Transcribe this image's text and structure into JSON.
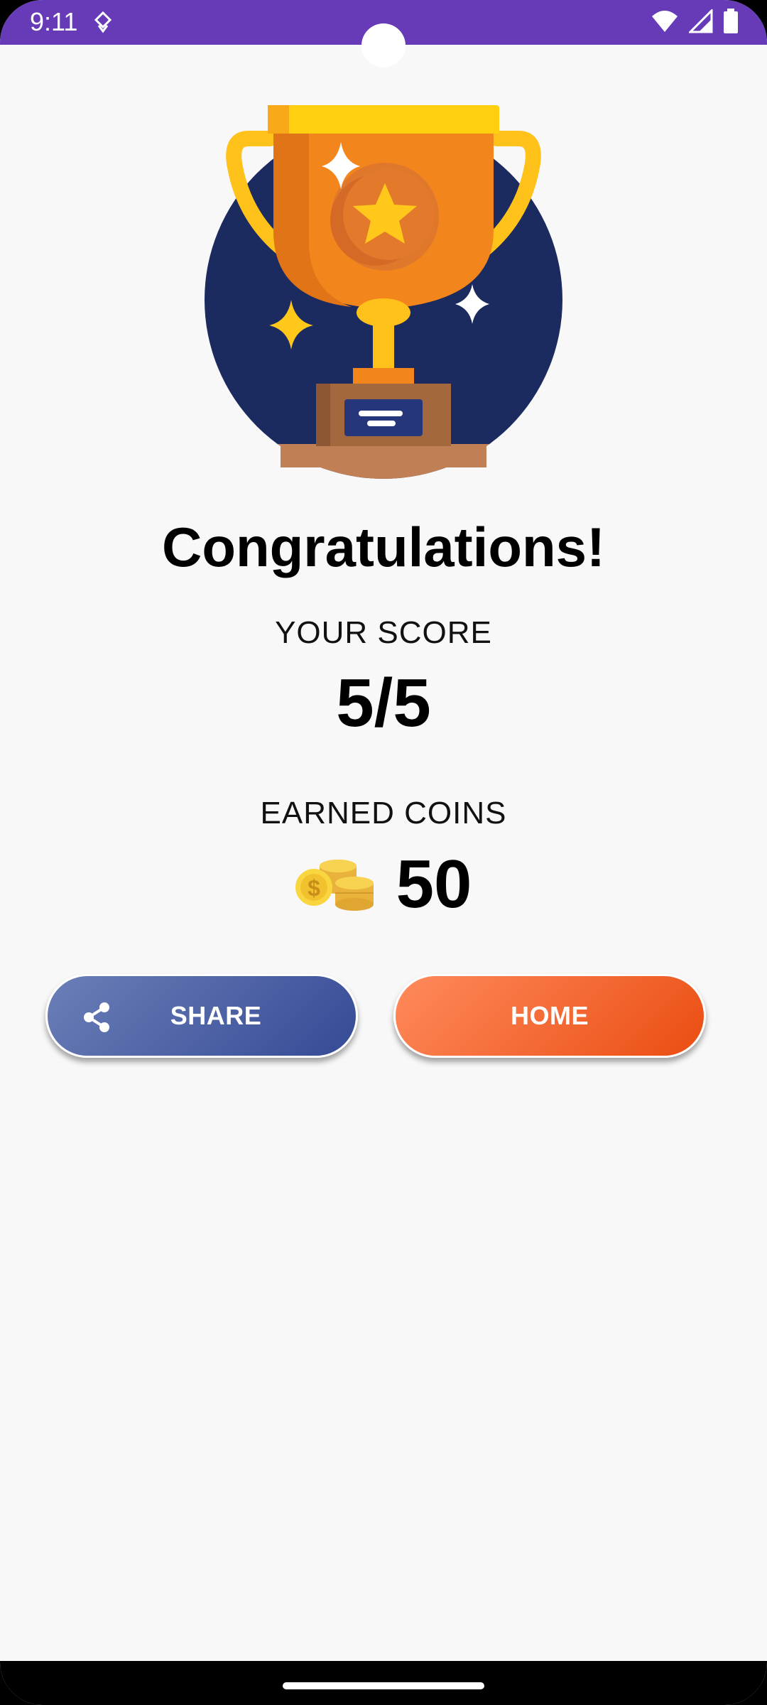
{
  "status_bar": {
    "time": "9:11",
    "icons": [
      "data-saver-icon",
      "wifi-icon",
      "signal-icon",
      "battery-icon"
    ],
    "color": "#673ab7"
  },
  "result": {
    "title": "Congratulations!",
    "score_label": "YOUR SCORE",
    "score_value": "5/5",
    "coins_label": "EARNED COINS",
    "coins_value": "50"
  },
  "actions": {
    "share_label": "SHARE",
    "home_label": "HOME"
  },
  "colors": {
    "share_button": "#3f5296",
    "home_button": "#f26a30",
    "trophy_backdrop": "#1b2a5f"
  }
}
